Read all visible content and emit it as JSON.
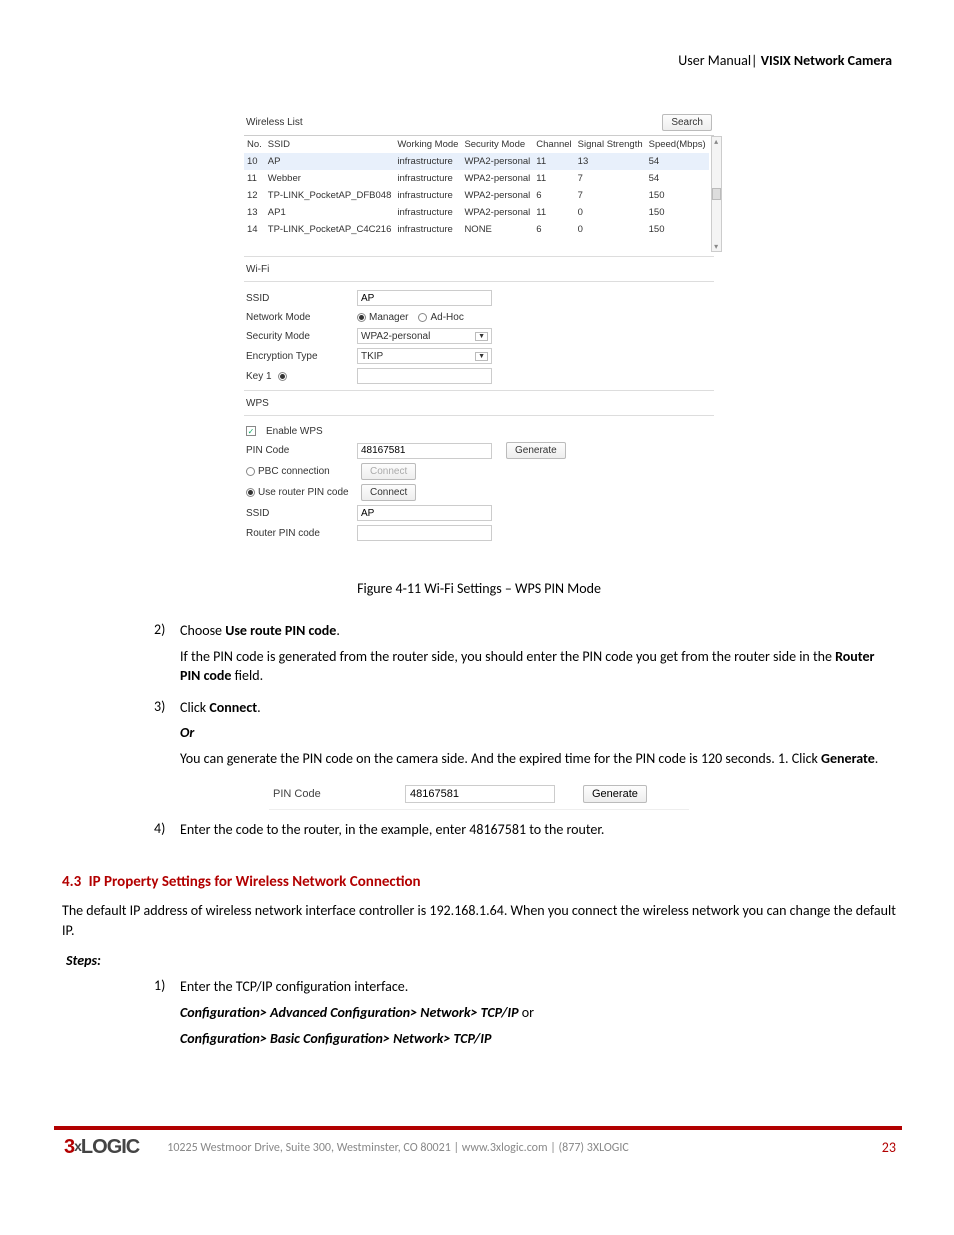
{
  "header": {
    "left": "User Manual|",
    "right": "VISIX Network Camera"
  },
  "panel": {
    "wireless_list_title": "Wireless List",
    "search_btn": "Search",
    "cols": [
      "No.",
      "SSID",
      "Working Mode",
      "Security Mode",
      "Channel",
      "Signal Strength",
      "Speed(Mbps)"
    ],
    "rows": [
      {
        "no": "10",
        "ssid": "AP",
        "wm": "infrastructure",
        "sm": "WPA2-personal",
        "ch": "11",
        "ss": "13",
        "sp": "54",
        "sel": true
      },
      {
        "no": "11",
        "ssid": "Webber",
        "wm": "infrastructure",
        "sm": "WPA2-personal",
        "ch": "11",
        "ss": "7",
        "sp": "54"
      },
      {
        "no": "12",
        "ssid": "TP-LINK_PocketAP_DFB048",
        "wm": "infrastructure",
        "sm": "WPA2-personal",
        "ch": "6",
        "ss": "7",
        "sp": "150"
      },
      {
        "no": "13",
        "ssid": "AP1",
        "wm": "infrastructure",
        "sm": "WPA2-personal",
        "ch": "11",
        "ss": "0",
        "sp": "150"
      },
      {
        "no": "14",
        "ssid": "TP-LINK_PocketAP_C4C216",
        "wm": "infrastructure",
        "sm": "NONE",
        "ch": "6",
        "ss": "0",
        "sp": "150"
      }
    ],
    "wifi": {
      "title": "Wi-Fi",
      "ssid_label": "SSID",
      "ssid_value": "AP",
      "netmode_label": "Network Mode",
      "netmode_manager": "Manager",
      "netmode_adhoc": "Ad-Hoc",
      "secmode_label": "Security Mode",
      "secmode_value": "WPA2-personal",
      "enc_label": "Encryption Type",
      "enc_value": "TKIP",
      "key_label": "Key 1"
    },
    "wps": {
      "title": "WPS",
      "enable": "Enable WPS",
      "pin_label": "PIN Code",
      "pin_value": "48167581",
      "generate": "Generate",
      "pbc_label": "PBC connection",
      "connect1": "Connect",
      "router_pin_label": "Use router PIN code",
      "connect2": "Connect",
      "ssid_label": "SSID",
      "ssid_value": "AP",
      "rpin_label": "Router PIN code"
    }
  },
  "caption": {
    "prefix": "Figure 4-11 ",
    "text": "Wi-Fi Settings – WPS PIN Mode"
  },
  "steps_a": {
    "s2_num": "2)",
    "s2_a": "Choose ",
    "s2_b": "Use route PIN code",
    "s2_c": ".",
    "s2_p": "If the PIN code is generated from the router side, you should enter the PIN code you get from the router side in the ",
    "s2_pb": "Router PIN code",
    "s2_pc": " field.",
    "s3_num": "3)",
    "s3_a": "Click ",
    "s3_b": "Connect",
    "s3_c": ".",
    "or": "Or",
    "s3_p_a": "You can generate the PIN code on the camera side. And the expired time for the PIN code is 120 seconds. 1. Click ",
    "s3_p_b": "Generate",
    "s3_p_c": "."
  },
  "snippet": {
    "label": "PIN Code",
    "value": "48167581",
    "btn": "Generate"
  },
  "s4": {
    "num": "4)",
    "text": "Enter the code to the router, in the example, enter 48167581 to the router."
  },
  "section": {
    "num": "4.3",
    "title": "IP Property Settings for Wireless Network Connection",
    "p": "The default IP address of wireless network interface controller is 192.168.1.64. When you connect the wireless network you can change the default IP.",
    "steps_label": "Steps:",
    "s1_num": "1)",
    "s1": "Enter the TCP/IP configuration interface.",
    "nav1": "Configuration> Advanced Configuration> Network> TCP/IP",
    "nav_or": " or",
    "nav2": "Configuration> Basic Configuration> Network> TCP/IP"
  },
  "footer": {
    "logo_a": "3",
    "logo_x": "x",
    "logo_b": "LOGIC",
    "addr": "10225 Westmoor Drive, Suite 300, Westminster, CO 80021 | www.3xlogic.com | (877) 3XLOGIC",
    "page": "23"
  }
}
